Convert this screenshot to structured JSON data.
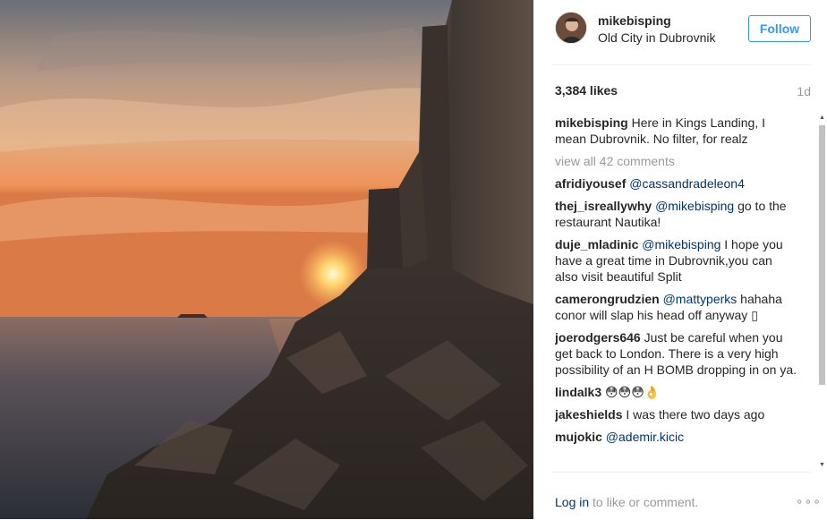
{
  "post": {
    "username": "mikebisping",
    "location": "Old City in Dubrovnik",
    "follow_label": "Follow",
    "likes": "3,384 likes",
    "age": "1d"
  },
  "caption": {
    "author": "mikebisping",
    "text": "Here in Kings Landing, I mean Dubrovnik. No filter, for realz"
  },
  "view_all": "view all 42 comments",
  "comments": [
    {
      "author": "afridiyousef",
      "mention": "@cassandradeleon4",
      "text": ""
    },
    {
      "author": "thej_isreallywhy",
      "mention": "@mikebisping",
      "text": "go to the restaurant Nautika!"
    },
    {
      "author": "duje_mladinic",
      "mention": "@mikebisping",
      "text": "I hope you have a great time in Dubrovnik,you can also visit beautiful Split"
    },
    {
      "author": "camerongrudzien",
      "mention": "@mattyperks",
      "text": "hahaha conor will slap his head off anyway ▯"
    },
    {
      "author": "joerodgers646",
      "mention": "",
      "text": "Just be careful when you get back to London. There is a very high possibility of an H BOMB dropping in on ya."
    },
    {
      "author": "lindalk3",
      "mention": "",
      "text": "😳😳😳👌"
    },
    {
      "author": "jakeshields",
      "mention": "",
      "text": "I was there two days ago"
    },
    {
      "author": "mujokic",
      "mention": "@ademir.kicic",
      "text": ""
    }
  ],
  "footer": {
    "login_link": "Log in",
    "login_text": "to like or comment.",
    "more": "∘∘∘"
  },
  "colors": {
    "link_blue": "#003569",
    "follow_blue": "#3897f0",
    "muted": "#999999"
  }
}
